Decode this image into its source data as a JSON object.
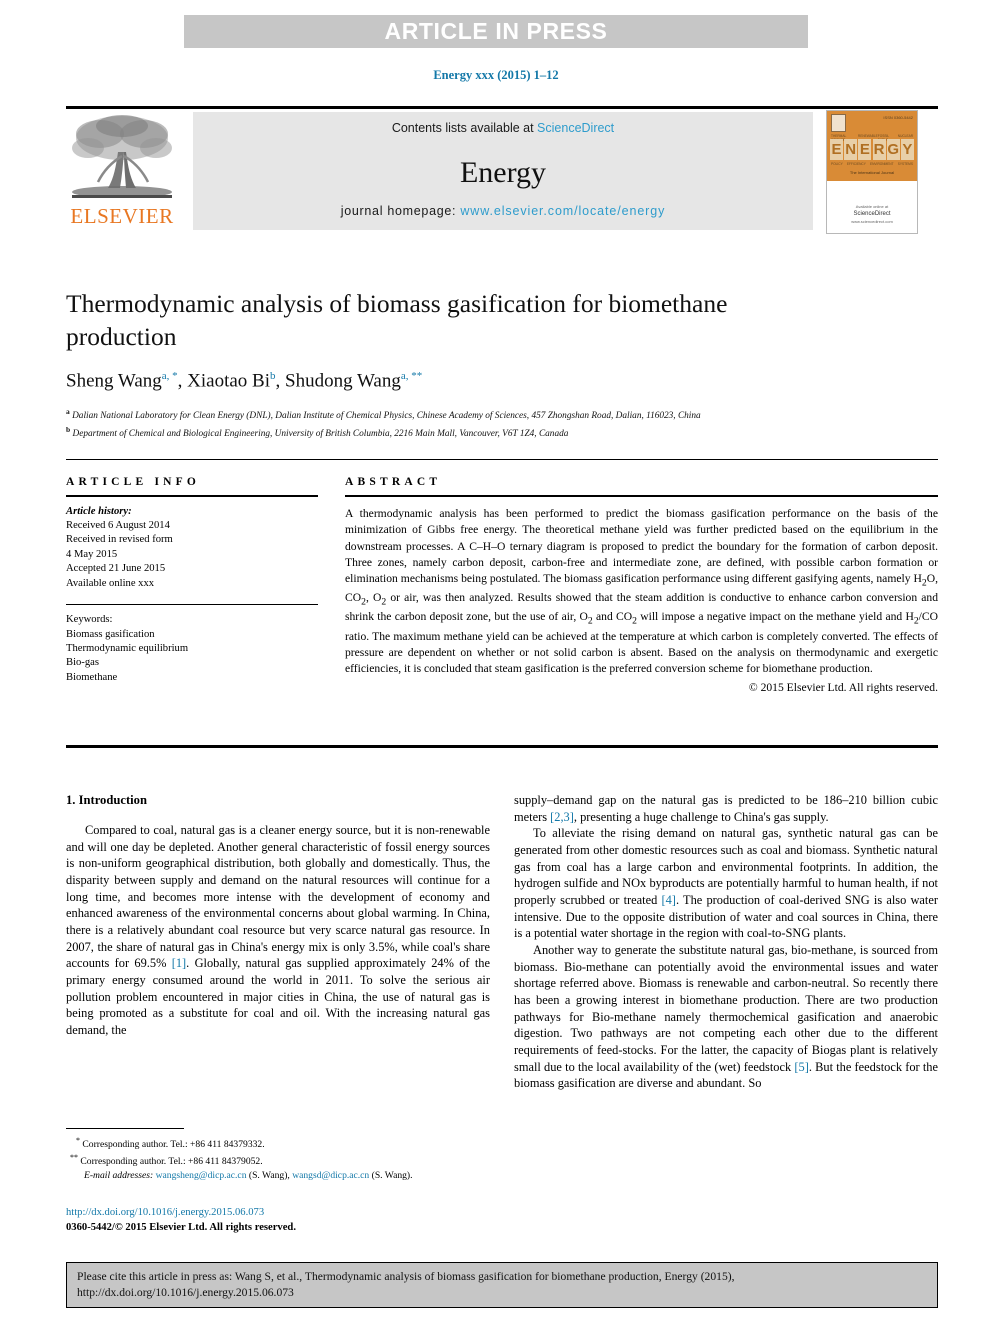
{
  "banner": {
    "text": "ARTICLE IN PRESS"
  },
  "running_head": "Energy xxx (2015) 1–12",
  "masthead": {
    "contents_prefix": "Contents lists available at ",
    "sciencedirect": "ScienceDirect",
    "journal_name": "Energy",
    "homepage_prefix": "journal homepage: ",
    "homepage_url": "www.elsevier.com/locate/energy",
    "publisher_word": "ELSEVIER",
    "cover": {
      "title_letters": [
        "E",
        "N",
        "E",
        "R",
        "G",
        "Y"
      ],
      "issue_code": "ISSN 0360-5442",
      "tabs": [
        "THERMAL SCIENCE",
        "RENEWABLE",
        "FOSSIL FUELS",
        "NUCLEAR"
      ],
      "sub_tabs": [
        "POLICY",
        "EFFICIENCY",
        "ENVIRONMENT",
        "SYSTEMS"
      ],
      "tagline": "The International Journal",
      "foot_small": "Available online at",
      "foot_big": "ScienceDirect",
      "foot_url": "www.sciencedirect.com"
    }
  },
  "article": {
    "title": "Thermodynamic analysis of biomass gasification for biomethane production",
    "authors": [
      {
        "name": "Sheng Wang",
        "marks": "a, *"
      },
      {
        "name": "Xiaotao Bi",
        "marks": "b"
      },
      {
        "name": "Shudong Wang",
        "marks": "a, **"
      }
    ],
    "affiliations": [
      {
        "mark": "a",
        "text": "Dalian National Laboratory for Clean Energy (DNL), Dalian Institute of Chemical Physics, Chinese Academy of Sciences, 457 Zhongshan Road, Dalian, 116023, China"
      },
      {
        "mark": "b",
        "text": "Department of Chemical and Biological Engineering, University of British Columbia, 2216 Main Mall, Vancouver, V6T 1Z4, Canada"
      }
    ]
  },
  "article_info": {
    "label": "ARTICLE INFO",
    "history_heading": "Article history:",
    "history_lines": [
      "Received 6 August 2014",
      "Received in revised form",
      "4 May 2015",
      "Accepted 21 June 2015",
      "Available online xxx"
    ],
    "keywords_heading": "Keywords:",
    "keywords": [
      "Biomass gasification",
      "Thermodynamic equilibrium",
      "Bio-gas",
      "Biomethane"
    ]
  },
  "abstract": {
    "label": "ABSTRACT",
    "text": "A thermodynamic analysis has been performed to predict the biomass gasification performance on the basis of the minimization of Gibbs free energy. The theoretical methane yield was further predicted based on the equilibrium in the downstream processes. A C–H–O ternary diagram is proposed to predict the boundary for the formation of carbon deposit. Three zones, namely carbon deposit, carbon-free and intermediate zone, are defined, with possible carbon formation or elimination mechanisms being postulated. The biomass gasification performance using different gasifying agents, namely H2O, CO2, O2 or air, was then analyzed. Results showed that the steam addition is conductive to enhance carbon conversion and shrink the carbon deposit zone, but the use of air, O2 and CO2 will impose a negative impact on the methane yield and H2/CO ratio. The maximum methane yield can be achieved at the temperature at which carbon is completely converted. The effects of pressure are dependent on whether or not solid carbon is absent. Based on the analysis on thermodynamic and exergetic efficiencies, it is concluded that steam gasification is the preferred conversion scheme for biomethane production.",
    "copyright": "© 2015 Elsevier Ltd. All rights reserved."
  },
  "body": {
    "section_heading": "1. Introduction",
    "left_paragraphs": [
      "Compared to coal, natural gas is a cleaner energy source, but it is non-renewable and will one day be depleted. Another general characteristic of fossil energy sources is non-uniform geographical distribution, both globally and domestically. Thus, the disparity between supply and demand on the natural resources will continue for a long time, and becomes more intense with the development of economy and enhanced awareness of the environmental concerns about global warming. In China, there is a relatively abundant coal resource but very scarce natural gas resource. In 2007, the share of natural gas in China's energy mix is only 3.5%, while coal's share accounts for 69.5% [1]. Globally, natural gas supplied approximately 24% of the primary energy consumed around the world in 2011. To solve the serious air pollution problem encountered in major cities in China, the use of natural gas is being promoted as a substitute for coal and oil. With the increasing natural gas demand, the"
    ],
    "right_paragraphs": [
      "supply–demand gap on the natural gas is predicted to be 186–210 billion cubic meters [2,3], presenting a huge challenge to China's gas supply.",
      "To alleviate the rising demand on natural gas, synthetic natural gas can be generated from other domestic resources such as coal and biomass. Synthetic natural gas from coal has a large carbon and environmental footprints. In addition, the hydrogen sulfide and NOx byproducts are potentially harmful to human health, if not properly scrubbed or treated [4]. The production of coal-derived SNG is also water intensive. Due to the opposite distribution of water and coal sources in China, there is a potential water shortage in the region with coal-to-SNG plants.",
      "Another way to generate the substitute natural gas, bio-methane, is sourced from biomass. Bio-methane can potentially avoid the environmental issues and water shortage referred above. Biomass is renewable and carbon-neutral. So recently there has been a growing interest in biomethane production. There are two production pathways for Bio-methane namely thermochemical gasification and anaerobic digestion. Two pathways are not competing each other due to the different requirements of feed-stocks. For the latter, the capacity of Biogas plant is relatively small due to the local availability of the (wet) feedstock [5]. But the feedstock for the biomass gasification are diverse and abundant. So"
    ]
  },
  "footnotes": {
    "corresponding_1": "Corresponding author. Tel.: +86 411 84379332.",
    "corresponding_1_mark": "*",
    "corresponding_2": "Corresponding author. Tel.: +86 411 84379052.",
    "corresponding_2_mark": "**",
    "email_label": "E-mail addresses:",
    "email_1": "wangsheng@dicp.ac.cn",
    "email_1_owner": "(S. Wang),",
    "email_2": "wangsd@dicp.ac.cn",
    "email_2_owner": "(S. Wang)."
  },
  "doi_block": {
    "doi_url": "http://dx.doi.org/10.1016/j.energy.2015.06.073",
    "issn_line": "0360-5442/© 2015 Elsevier Ltd. All rights reserved."
  },
  "citation_box": {
    "line1": "Please cite this article in press as: Wang S, et al., Thermodynamic analysis of biomass gasification for biomethane production, Energy (2015),",
    "line2": "http://dx.doi.org/10.1016/j.energy.2015.06.073"
  },
  "colors": {
    "link_blue": "#1378a8",
    "accent_blue": "#2e9ccc",
    "elsevier_orange": "#e87722",
    "banner_gray": "#c6c6c6",
    "masthead_gray": "#e6e6e6"
  }
}
